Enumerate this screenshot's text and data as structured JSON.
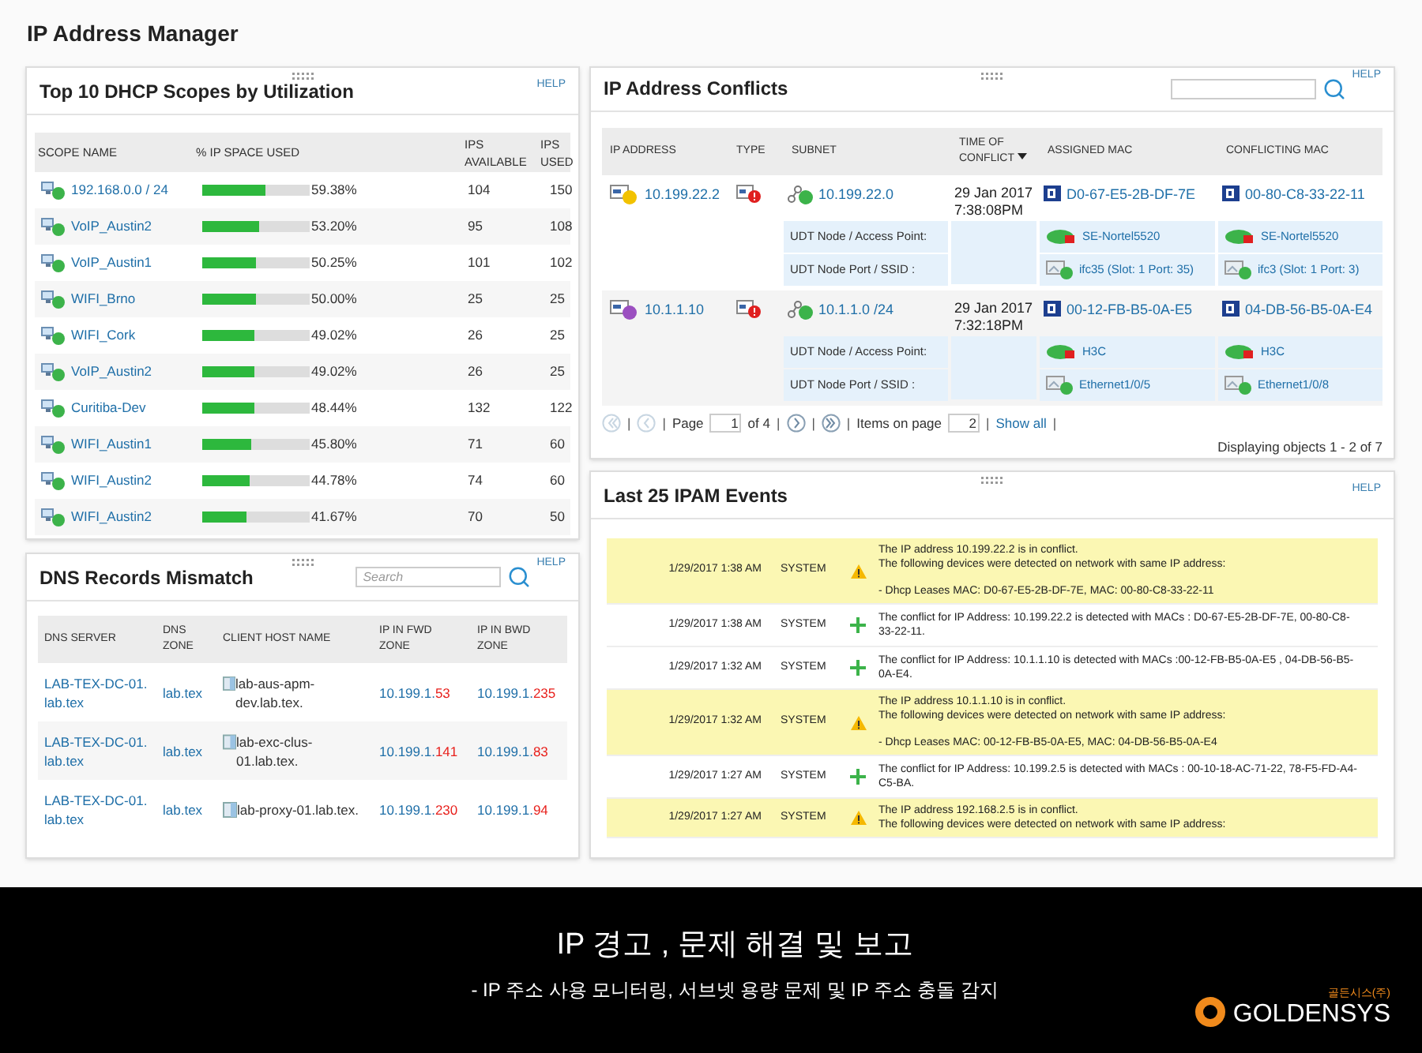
{
  "page_title": "IP Address Manager",
  "dhcp": {
    "title": "Top 10 DHCP Scopes by Utilization",
    "help": "HELP",
    "columns": [
      "SCOPE NAME",
      "% IP SPACE USED",
      "IPS AVAILABLE",
      "IPS USED"
    ],
    "rows": [
      {
        "name": "192.168.0.0 / 24",
        "level": 0.5938,
        "percent": "59.38%",
        "available": "104",
        "used": "150"
      },
      {
        "name": "VoIP_Austin2",
        "level": 0.532,
        "percent": "53.20%",
        "available": "95",
        "used": "108"
      },
      {
        "name": "VoIP_Austin1",
        "level": 0.5025,
        "percent": "50.25%",
        "available": "101",
        "used": "102"
      },
      {
        "name": "WIFI_Brno",
        "level": 0.5,
        "percent": "50.00%",
        "available": "25",
        "used": "25"
      },
      {
        "name": "WIFI_Cork",
        "level": 0.4902,
        "percent": "49.02%",
        "available": "26",
        "used": "25"
      },
      {
        "name": "VoIP_Austin2",
        "level": 0.4902,
        "percent": "49.02%",
        "available": "26",
        "used": "25"
      },
      {
        "name": "Curitiba-Dev",
        "level": 0.4844,
        "percent": "48.44%",
        "available": "132",
        "used": "122"
      },
      {
        "name": "WIFI_Austin1",
        "level": 0.458,
        "percent": "45.80%",
        "available": "71",
        "used": "60"
      },
      {
        "name": "WIFI_Austin2",
        "level": 0.4478,
        "percent": "44.78%",
        "available": "74",
        "used": "60"
      },
      {
        "name": "WIFI_Austin2",
        "level": 0.4167,
        "percent": "41.67%",
        "available": "70",
        "used": "50"
      }
    ]
  },
  "dns": {
    "title": "DNS Records Mismatch",
    "search_placeholder": "Search",
    "help": "HELP",
    "columns": [
      "DNS SERVER",
      "DNS ZONE",
      "CLIENT HOST NAME",
      "IP IN FWD ZONE",
      "IP IN BWD ZONE"
    ],
    "rows": [
      {
        "server": "LAB-TEX-DC-01.lab.tex",
        "zone": "lab.tex",
        "host": "lab-aus-apm-dev.lab.tex.",
        "fwd_prefix": "10.199.1.",
        "fwd_suffix": "53",
        "bwd_prefix": "10.199.1.",
        "bwd_suffix": "235"
      },
      {
        "server": "LAB-TEX-DC-01.lab.tex",
        "zone": "lab.tex",
        "host": "lab-exc-clus-01.lab.tex.",
        "fwd_prefix": "10.199.1.",
        "fwd_suffix": "141",
        "bwd_prefix": "10.199.1.",
        "bwd_suffix": "83"
      },
      {
        "server": "LAB-TEX-DC-01.lab.tex",
        "zone": "lab.tex",
        "host": "lab-proxy-01.lab.tex.",
        "fwd_prefix": "10.199.1.",
        "fwd_suffix": "230",
        "bwd_prefix": "10.199.1.",
        "bwd_suffix": "94"
      }
    ]
  },
  "conflicts": {
    "title": "IP Address Conflicts",
    "help": "HELP",
    "columns": [
      "IP ADDRESS",
      "TYPE",
      "SUBNET",
      "TIME OF CONFLICT",
      "ASSIGNED MAC",
      "CONFLICTING MAC"
    ],
    "rows": [
      {
        "ip": "10.199.22.2",
        "color": "#f2c200",
        "subnet": "10.199.22.0",
        "date": "29 Jan 2017",
        "time": "7:38:08PM",
        "assigned_mac": "D0-67-E5-2B-DF-7E",
        "conflicting_mac": "00-80-C8-33-22-11",
        "node_label": "UDT Node / Access Point:",
        "port_label": "UDT Node Port / SSID :",
        "assigned_node": "SE-Nortel5520",
        "assigned_port": "ifc35 (Slot: 1 Port: 35)",
        "conflicting_node": "SE-Nortel5520",
        "conflicting_port": "ifc3 (Slot: 1 Port: 3)"
      },
      {
        "ip": "10.1.1.10",
        "color": "#9b4fc0",
        "subnet": "10.1.1.0 /24",
        "date": "29 Jan 2017",
        "time": "7:32:18PM",
        "assigned_mac": "00-12-FB-B5-0A-E5",
        "conflicting_mac": "04-DB-56-B5-0A-E4",
        "node_label": "UDT Node / Access Point:",
        "port_label": "UDT Node Port / SSID :",
        "assigned_node": "H3C",
        "assigned_port": "Ethernet1/0/5",
        "conflicting_node": "H3C",
        "conflicting_port": "Ethernet1/0/8"
      }
    ],
    "pager": [
      {
        "kind": "first"
      },
      {
        "kind": "sep",
        "text": "|"
      },
      {
        "kind": "prev"
      },
      {
        "kind": "sep",
        "text": "|"
      },
      {
        "kind": "label",
        "text": "Page"
      },
      {
        "kind": "input",
        "text": "1"
      },
      {
        "kind": "label",
        "text": "of 4"
      },
      {
        "kind": "sep",
        "text": "|"
      },
      {
        "kind": "next"
      },
      {
        "kind": "sep",
        "text": "|"
      },
      {
        "kind": "last"
      },
      {
        "kind": "sep",
        "text": "|"
      },
      {
        "kind": "label",
        "text": "Items on page"
      },
      {
        "kind": "input",
        "text": "2"
      },
      {
        "kind": "sep",
        "text": "|"
      },
      {
        "kind": "link",
        "text": "Show all"
      },
      {
        "kind": "sep",
        "text": "|"
      }
    ],
    "summary": "Displaying objects 1 - 2 of 7"
  },
  "events": {
    "title": "Last 25 IPAM Events",
    "help": "HELP",
    "rows": [
      {
        "kind": "warning",
        "time": "1/29/2017 1:38 AM",
        "source": "SYSTEM",
        "message": [
          "The IP address 10.199.22.2 is in conflict.",
          "The following devices were detected on network with same IP address:"
        ],
        "detail": "- Dhcp Leases MAC: D0-67-E5-2B-DF-7E, MAC: 00-80-C8-33-22-11"
      },
      {
        "kind": "added",
        "time": "1/29/2017 1:38 AM",
        "source": "SYSTEM",
        "message": [
          "The conflict for IP Address: 10.199.22.2 is detected with MACs : D0-67-E5-2B-DF-7E, 00-80-C8-33-22-11."
        ]
      },
      {
        "kind": "added",
        "time": "1/29/2017 1:32 AM",
        "source": "SYSTEM",
        "message": [
          "The conflict for IP Address: 10.1.1.10 is detected with MACs :00-12-FB-B5-0A-E5 , 04-DB-56-B5-0A-E4."
        ]
      },
      {
        "kind": "warning",
        "time": "1/29/2017 1:32 AM",
        "source": "SYSTEM",
        "message": [
          "The IP address 10.1.1.10 is in conflict.",
          "The following devices were detected on network with same IP address:"
        ],
        "detail": "- Dhcp Leases MAC: 00-12-FB-B5-0A-E5, MAC: 04-DB-56-B5-0A-E4"
      },
      {
        "kind": "added",
        "time": "1/29/2017 1:27 AM",
        "source": "SYSTEM",
        "message": [
          "The conflict for IP Address: 10.199.2.5 is detected with MACs : 00-10-18-AC-71-22, 78-F5-FD-A4-C5-BA."
        ]
      },
      {
        "kind": "warning",
        "time": "1/29/2017 1:27 AM",
        "source": "SYSTEM",
        "message": [
          "The IP address 192.168.2.5 is in conflict.",
          "The following devices were detected on network with same IP address:"
        ]
      }
    ]
  },
  "banner": {
    "headline": "IP 경고 , 문제 해결 및 보고",
    "subline": "- IP 주소 사용 모니터링, 서브넷 용량 문제 및 IP 주소 충돌 감지",
    "logo_text": "GOLDENSYS",
    "logo_caption": "골든시스(주)"
  }
}
